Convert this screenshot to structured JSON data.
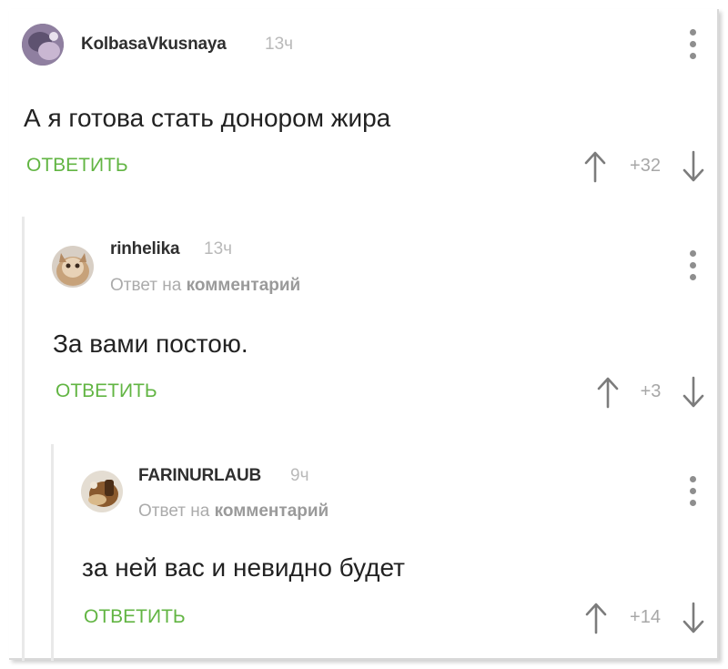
{
  "comments": [
    {
      "username": "KolbasaVkusnaya",
      "time": "13ч",
      "text": "А я готова стать донором жира",
      "reply_label": "ОТВЕТИТЬ",
      "score": "+32"
    },
    {
      "username": "rinhelika",
      "time": "13ч",
      "reply_to_prefix": "Ответ на",
      "reply_to_target": "комментарий",
      "text": "За вами постою.",
      "reply_label": "ОТВЕТИТЬ",
      "score": "+3"
    },
    {
      "username": "FARINURLAUB",
      "time": "9ч",
      "reply_to_prefix": "Ответ на",
      "reply_to_target": "комментарий",
      "text": "за ней вас и невидно будет",
      "reply_label": "ОТВЕТИТЬ",
      "score": "+14"
    }
  ],
  "icons": {
    "menu": "more-vertical-icon",
    "upvote": "arrow-up-icon",
    "downvote": "arrow-down-icon"
  },
  "colors": {
    "accent": "#62b543",
    "muted": "#a7a7a7",
    "text": "#222222"
  }
}
